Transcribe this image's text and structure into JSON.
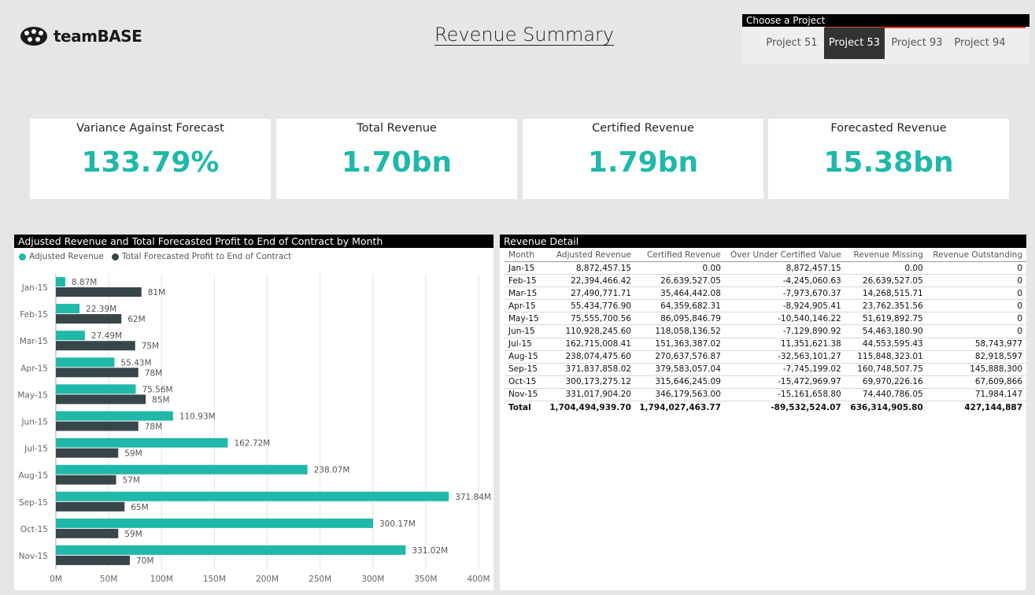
{
  "header": {
    "logo_text": "teamBASE",
    "title": "Revenue Summary"
  },
  "slicer": {
    "title": "Choose a Project",
    "items": [
      "Project 51",
      "Project 53",
      "Project 93",
      "Project 94"
    ],
    "selected": "Project 53"
  },
  "kpis": [
    {
      "label": "Variance Against Forecast",
      "value": "133.79%"
    },
    {
      "label": "Total Revenue",
      "value": "1.70bn"
    },
    {
      "label": "Certified Revenue",
      "value": "1.79bn"
    },
    {
      "label": "Forecasted Revenue",
      "value": "15.38bn"
    }
  ],
  "colors": {
    "accent": "#1fb8a9",
    "dark": "#374649",
    "slicer_accent": "#e8452c"
  },
  "chart": {
    "title": "Adjusted Revenue and Total Forecasted Profit to End of Contract by Month"
  },
  "chart_data": {
    "type": "bar",
    "orientation": "horizontal",
    "title": "Adjusted Revenue and Total Forecasted Profit to End of Contract by Month",
    "categories": [
      "Jan-15",
      "Feb-15",
      "Mar-15",
      "Apr-15",
      "May-15",
      "Jun-15",
      "Jul-15",
      "Aug-15",
      "Sep-15",
      "Oct-15",
      "Nov-15"
    ],
    "series": [
      {
        "name": "Adjusted Revenue",
        "color": "#1fb8a9",
        "values": [
          8.87,
          22.39,
          27.49,
          55.43,
          75.56,
          110.93,
          162.72,
          238.07,
          371.84,
          300.17,
          331.02
        ],
        "labels": [
          "8.87M",
          "22.39M",
          "27.49M",
          "55.43M",
          "75.56M",
          "110.93M",
          "162.72M",
          "238.07M",
          "371.84M",
          "300.17M",
          "331.02M"
        ]
      },
      {
        "name": "Total Forecasted Profit to End of Contract",
        "color": "#374649",
        "values": [
          81,
          62,
          75,
          78,
          85,
          78,
          59,
          57,
          65,
          59,
          70
        ],
        "labels": [
          "81M",
          "62M",
          "75M",
          "78M",
          "85M",
          "78M",
          "59M",
          "57M",
          "65M",
          "59M",
          "70M"
        ]
      }
    ],
    "xlim": [
      0,
      400
    ],
    "xticks": [
      "0M",
      "50M",
      "100M",
      "150M",
      "200M",
      "250M",
      "300M",
      "350M",
      "400M"
    ],
    "grid": true,
    "legend": "top-left"
  },
  "table": {
    "title": "Revenue Detail",
    "columns": [
      "Month",
      "Adjusted Revenue",
      "Certified Revenue",
      "Over Under Certified Value",
      "Revenue Missing",
      "Revenue Outstanding"
    ],
    "rows": [
      [
        "Jan-15",
        "8,872,457.15",
        "0.00",
        "8,872,457.15",
        "0.00",
        "0"
      ],
      [
        "Feb-15",
        "22,394,466.42",
        "26,639,527.05",
        "-4,245,060.63",
        "26,639,527.05",
        "0"
      ],
      [
        "Mar-15",
        "27,490,771.71",
        "35,464,442.08",
        "-7,973,670.37",
        "14,268,515.71",
        "0"
      ],
      [
        "Apr-15",
        "55,434,776.90",
        "64,359,682.31",
        "-8,924,905.41",
        "23,762,351.56",
        "0"
      ],
      [
        "May-15",
        "75,555,700.56",
        "86,095,846.79",
        "-10,540,146.22",
        "51,619,892.75",
        "0"
      ],
      [
        "Jun-15",
        "110,928,245.60",
        "118,058,136.52",
        "-7,129,890.92",
        "54,463,180.90",
        "0"
      ],
      [
        "Jul-15",
        "162,715,008.41",
        "151,363,387.02",
        "11,351,621.38",
        "44,553,595.43",
        "58,743,977"
      ],
      [
        "Aug-15",
        "238,074,475.60",
        "270,637,576.87",
        "-32,563,101.27",
        "115,848,323.01",
        "82,918,597"
      ],
      [
        "Sep-15",
        "371,837,858.02",
        "379,583,057.04",
        "-7,745,199.02",
        "160,748,507.75",
        "145,888,300"
      ],
      [
        "Oct-15",
        "300,173,275.12",
        "315,646,245.09",
        "-15,472,969.97",
        "69,970,226.16",
        "67,609,866"
      ],
      [
        "Nov-15",
        "331,017,904.20",
        "346,179,563.00",
        "-15,161,658.80",
        "74,440,786.05",
        "71,984,147"
      ]
    ],
    "total": [
      "Total",
      "1,704,494,939.70",
      "1,794,027,463.77",
      "-89,532,524.07",
      "636,314,905.80",
      "427,144,887"
    ]
  }
}
